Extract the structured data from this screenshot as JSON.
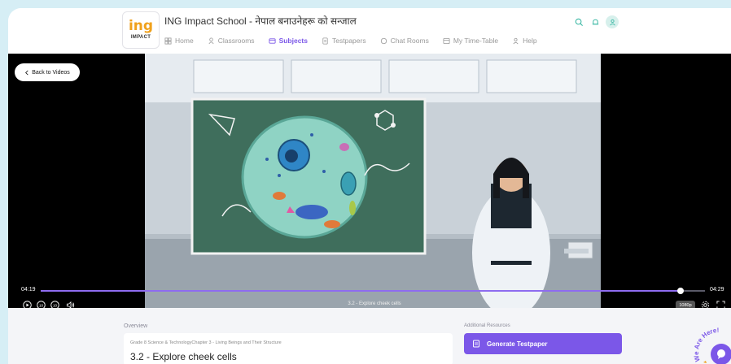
{
  "header": {
    "logo_text_main": "ing",
    "logo_text_sub": "IMPACT",
    "school_name": "ING Impact School - नेपाल बनाउनेहरू को सन्जाल",
    "nav": [
      {
        "label": "Home",
        "icon": "home-grid-icon",
        "active": false
      },
      {
        "label": "Classrooms",
        "icon": "classroom-icon",
        "active": false
      },
      {
        "label": "Subjects",
        "icon": "subjects-icon",
        "active": true
      },
      {
        "label": "Testpapers",
        "icon": "testpaper-icon",
        "active": false
      },
      {
        "label": "Chat Rooms",
        "icon": "chat-icon",
        "active": false
      },
      {
        "label": "My Time-Table",
        "icon": "timetable-icon",
        "active": false
      },
      {
        "label": "Help",
        "icon": "help-icon",
        "active": false
      }
    ],
    "icons": [
      "search-icon",
      "bell-icon",
      "user-avatar-icon"
    ]
  },
  "video": {
    "back_label": "Back to Videos",
    "current_time": "04:19",
    "duration": "04:29",
    "progress_fraction": 0.963,
    "title": "3.2 - Explore cheek cells",
    "quality": "1080p"
  },
  "overview": {
    "label": "Overview",
    "breadcrumb": "Grade 8 Science & TechnologyChapter 3 - Living Beings and Their Structure",
    "lesson_title": "3.2 - Explore cheek cells"
  },
  "resources": {
    "label": "Additional Resources",
    "generate_label": "Generate Testpaper"
  },
  "chat_widget": {
    "text": "We Are Here!"
  },
  "colors": {
    "accent": "#7b57e8",
    "page_bg": "#d6eef5",
    "chalkboard": "#3f6e5c"
  }
}
